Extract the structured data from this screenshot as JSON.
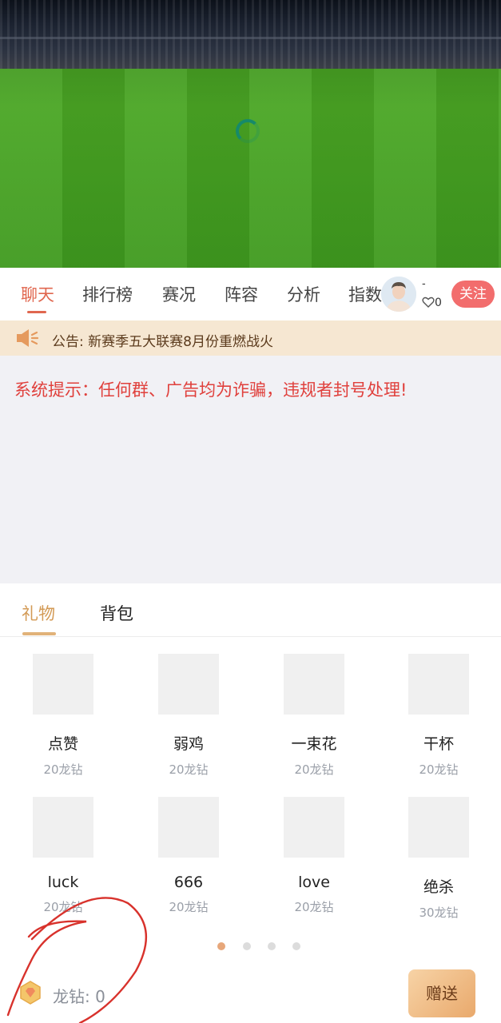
{
  "tabs": [
    {
      "label": "聊天",
      "active": true
    },
    {
      "label": "排行榜"
    },
    {
      "label": "赛况"
    },
    {
      "label": "阵容"
    },
    {
      "label": "分析"
    },
    {
      "label": "指数"
    }
  ],
  "streamer": {
    "name": "-",
    "followers": "0",
    "follow_label": "关注"
  },
  "notice": {
    "text": "公告: 新赛季五大联赛8月份重燃战火"
  },
  "chat": {
    "system_tip": "系统提示：任何群、广告均为诈骗，违规者封号处理!"
  },
  "gift_panel": {
    "tabs": [
      {
        "label": "礼物",
        "active": true
      },
      {
        "label": "背包"
      }
    ],
    "gifts": [
      {
        "name": "点赞",
        "price": "20龙钻"
      },
      {
        "name": "弱鸡",
        "price": "20龙钻"
      },
      {
        "name": "一束花",
        "price": "20龙钻"
      },
      {
        "name": "干杯",
        "price": "20龙钻"
      },
      {
        "name": "luck",
        "price": "20龙钻"
      },
      {
        "name": "666",
        "price": "20龙钻"
      },
      {
        "name": "love",
        "price": "20龙钻"
      },
      {
        "name": "绝杀",
        "price": "30龙钻"
      }
    ],
    "page_count": 4,
    "current_page": 1,
    "balance_label": "龙钻: 0",
    "send_label": "赠送"
  },
  "colors": {
    "accent": "#e0674f",
    "follow": "#f26d6d",
    "gift_accent": "#d39a55",
    "system_tip": "#e0403c"
  }
}
